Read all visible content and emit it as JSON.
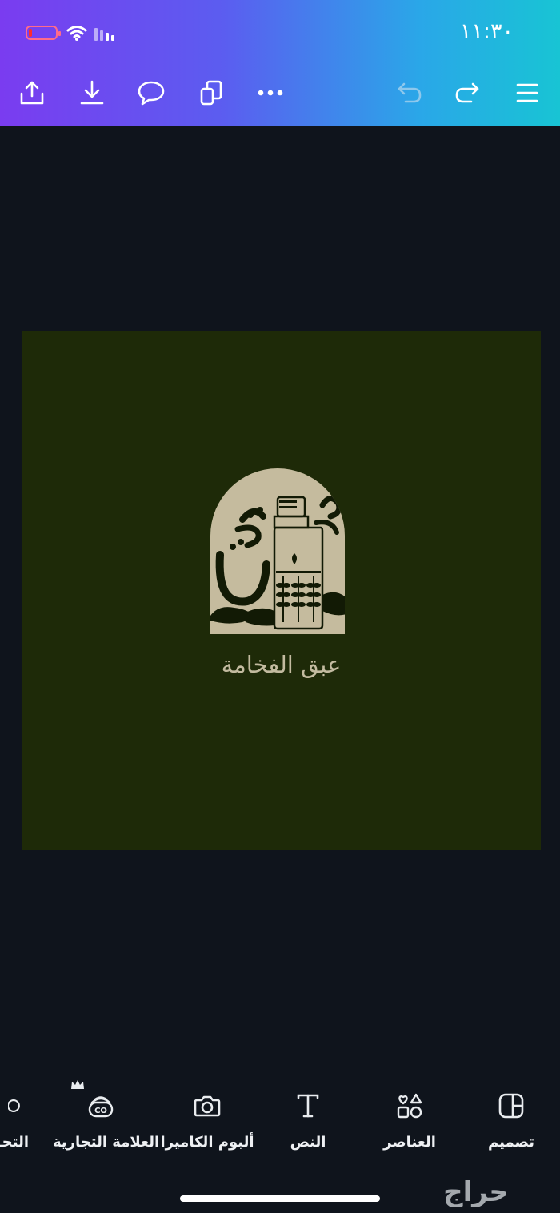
{
  "status_bar": {
    "time": "١١:٣٠"
  },
  "toolbar": {
    "icons": [
      "share-icon",
      "download-icon",
      "comment-icon",
      "copy-icon",
      "more-icon",
      "undo-icon",
      "redo-icon",
      "menu-icon"
    ]
  },
  "canvas": {
    "background": "#1e2a08",
    "logo_calligraphy": "عبق",
    "logo_text": "عبق الفخامة"
  },
  "bottom_tools": {
    "design": "تصميم",
    "elements": "العناصر",
    "text": "النص",
    "camera_roll": "ألبوم الكاميرا",
    "brand": "العلامة التجارية",
    "partial": "التحـ"
  },
  "watermark": "حراج",
  "colors": {
    "header_start": "#7a3cf0",
    "header_end": "#18c4d4",
    "app_background": "#0f141c",
    "logo_beige": "#c5bb9e"
  }
}
